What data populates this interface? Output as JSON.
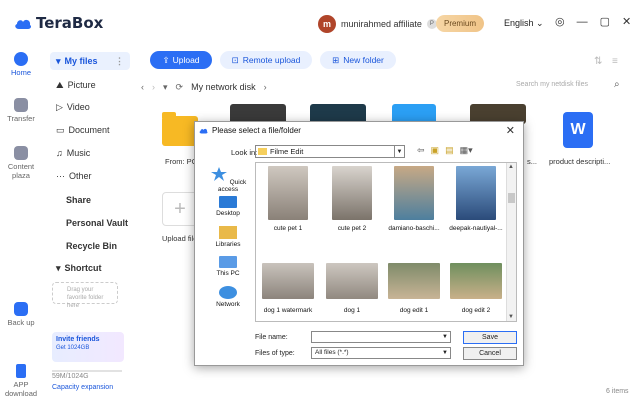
{
  "app": {
    "name": "TeraBox"
  },
  "header": {
    "avatar_letter": "m",
    "username": "munirahmed affiliate",
    "premium_label": "Premium",
    "language": "English"
  },
  "rail": {
    "home": "Home",
    "transfer": "Transfer",
    "content_plaza": "Content plaza",
    "back_up": "Back up",
    "app_download": "APP download"
  },
  "sidebar": {
    "my_files": "My files",
    "picture": "Picture",
    "video": "Video",
    "document": "Document",
    "music": "Music",
    "other": "Other",
    "share": "Share",
    "personal_vault": "Personal Vault",
    "recycle_bin": "Recycle Bin",
    "shortcut": "Shortcut",
    "drag_hint": "Drag your favorite folder here",
    "invite_title": "Invite friends",
    "invite_sub": "Get 1024GB",
    "storage": "59M/1024G",
    "capacity": "Capacity expansion"
  },
  "toolbar": {
    "upload": "Upload",
    "remote_upload": "Remote upload",
    "new_folder": "New folder"
  },
  "nav": {
    "breadcrumb": "My network disk",
    "search_placeholder": "Search my netdisk files"
  },
  "files": {
    "folder_label": "From: PC",
    "upload_label": "Upload file",
    "doc_label": "product descripti...",
    "partial_label": "s...",
    "items_count": "6 items"
  },
  "dialog": {
    "title": "Please select a file/folder",
    "lookin_label": "Look in:",
    "lookin_value": "Filme Edit",
    "places": [
      "Quick access",
      "Desktop",
      "Libraries",
      "This PC",
      "Network"
    ],
    "files": [
      {
        "name": "cute pet 1"
      },
      {
        "name": "cute pet 2"
      },
      {
        "name": "damiano-baschi..."
      },
      {
        "name": "deepak-nautiyal-..."
      },
      {
        "name": "dog 1 watermark"
      },
      {
        "name": "dog 1"
      },
      {
        "name": "dog edit 1"
      },
      {
        "name": "dog edit 2"
      }
    ],
    "filename_label": "File name:",
    "filetype_label": "Files of type:",
    "filetype_value": "All files (*.*)",
    "save": "Save",
    "cancel": "Cancel"
  },
  "colors": {
    "accent": "#2b6ef4",
    "folder": "#f7b924"
  }
}
